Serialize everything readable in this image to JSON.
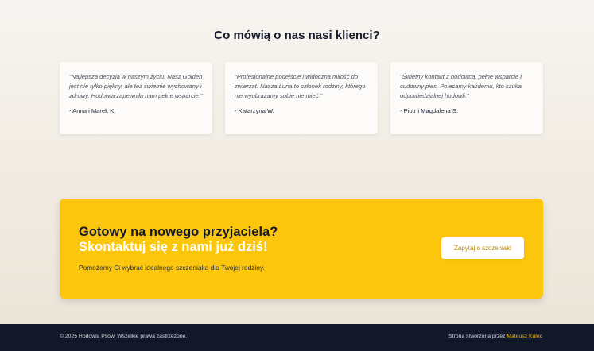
{
  "testimonials": {
    "title": "Co mówią o nas nasi klienci?",
    "items": [
      {
        "quote": "\"Najlepsza decyzja w naszym życiu. Nasz Golden jest nie tylko piękny, ale też świetnie wychowany i zdrowy. Hodowla zapewniła nam pełne wsparcie.\"",
        "author": "- Anna i Marek K."
      },
      {
        "quote": "\"Profesjonalne podejście i widoczna miłość do zwierząt. Nasza Luna to członek rodziny, którego nie wyobrażamy sobie nie mieć.\"",
        "author": "- Katarzyna W."
      },
      {
        "quote": "\"Świetny kontakt z hodowcą, pełne wsparcie i cudowny pies. Polecamy każdemu, kto szuka odpowiedzialnej hodowli.\"",
        "author": "- Piotr i Magdalena S."
      }
    ]
  },
  "cta": {
    "headline": "Gotowy na nowego przyjaciela?",
    "subheadline": "Skontaktuj się z nami już dziś!",
    "description": "Pomożemy Ci wybrać idealnego szczeniaka dla Twojej rodziny.",
    "button_label": "Zapytaj o szczeniaki",
    "accent_color": "#fbc60b"
  },
  "footer": {
    "copyright": "© 2025 Hodowla Psów. Wszelkie prawa zastrzeżone.",
    "credit_prefix": "Strona stworzona przez",
    "credit_author": "Mateusz Kulec",
    "background_color": "#121829",
    "link_color": "#f4b400"
  }
}
